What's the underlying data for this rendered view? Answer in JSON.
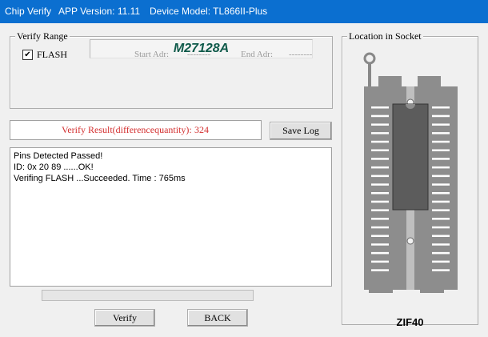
{
  "title": {
    "window_name": "Chip Verify",
    "app_version": "APP Version: 11.11",
    "device_model": "Device Model: TL866II-Plus"
  },
  "verify_range": {
    "legend": "Verify Range",
    "chip_name": "M27128A",
    "flash_checked": true,
    "flash_label": "FLASH",
    "start_label": "Start Adr:",
    "start_value": "--------",
    "end_label": "End Adr:",
    "end_value": "--------"
  },
  "result": {
    "label": "Verify Result(differencequantity):",
    "value": "324"
  },
  "buttons": {
    "save_log": "Save Log",
    "verify": "Verify",
    "back": "BACK"
  },
  "log": [
    "Pins Detected Passed!",
    "ID: 0x 20 89 ......OK!",
    "Verifing FLASH ...Succeeded. Time : 765ms"
  ],
  "progress": {
    "fraction": 0.0
  },
  "socket": {
    "legend": "Location in Socket",
    "zif_label": "ZIF40"
  }
}
